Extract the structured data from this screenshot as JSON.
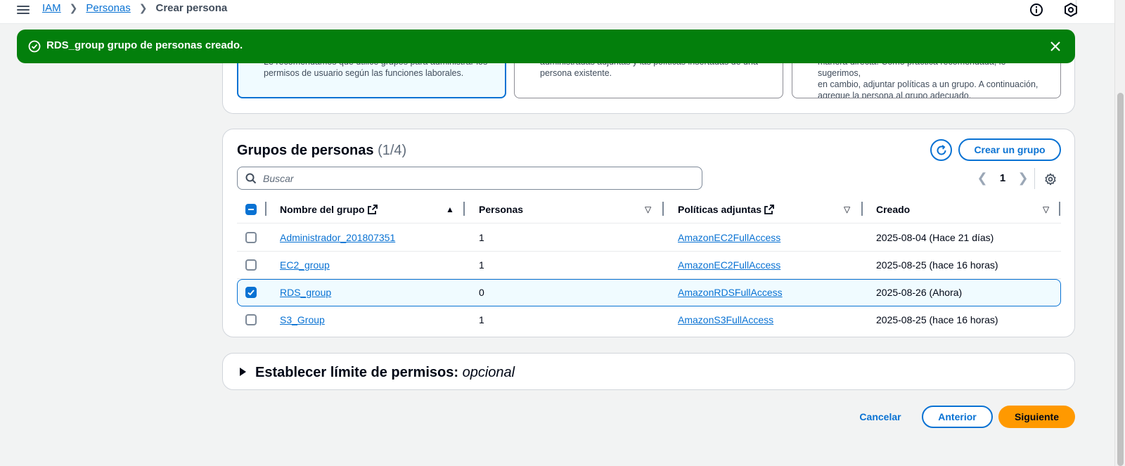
{
  "breadcrumb": {
    "root": "IAM",
    "parent": "Personas",
    "current": "Crear persona"
  },
  "flash": {
    "message": "RDS_group grupo de personas creado.",
    "type": "success",
    "color": "#037f0c"
  },
  "options": [
    {
      "line1": "Le recomendamos que utilice grupos para administrar los",
      "line2": "permisos de usuario según las funciones laborales.",
      "line3": "",
      "selected": true
    },
    {
      "line1": "administradas adjuntas y las políticas insertadas de una",
      "line2": "persona existente.",
      "line3": "",
      "selected": false
    },
    {
      "line1": "manera directa. Como práctica recomendada, le sugerimos,",
      "line2": "en cambio, adjuntar políticas a un grupo. A continuación,",
      "line3": "agregue la persona al grupo adecuado.",
      "selected": false
    }
  ],
  "groups": {
    "title": "Grupos de personas",
    "count": "(1/4)",
    "create_button": "Crear un grupo",
    "search_placeholder": "Buscar",
    "page": "1",
    "columns": {
      "name": "Nombre del grupo",
      "users": "Personas",
      "policies": "Políticas adjuntas",
      "created": "Creado"
    },
    "rows": [
      {
        "name": "Administrador_201807351",
        "users": "1",
        "policy": "AmazonEC2FullAccess",
        "created": "2025-08-04 (Hace 21 días)",
        "checked": false
      },
      {
        "name": "EC2_group",
        "users": "1",
        "policy": "AmazonEC2FullAccess",
        "created": "2025-08-25 (hace 16 horas)",
        "checked": false
      },
      {
        "name": "RDS_group",
        "users": "0",
        "policy": "AmazonRDSFullAccess",
        "created": "2025-08-26 (Ahora)",
        "checked": true
      },
      {
        "name": "S3_Group",
        "users": "1",
        "policy": "AmazonS3FullAccess",
        "created": "2025-08-25 (hace 16 horas)",
        "checked": false
      }
    ]
  },
  "boundary": {
    "title": "Establecer límite de permisos:",
    "optional": "opcional"
  },
  "footer": {
    "cancel": "Cancelar",
    "previous": "Anterior",
    "next": "Siguiente"
  },
  "colors": {
    "accent": "#0972d3",
    "primary_button": "#ff9900",
    "success": "#037f0c"
  }
}
